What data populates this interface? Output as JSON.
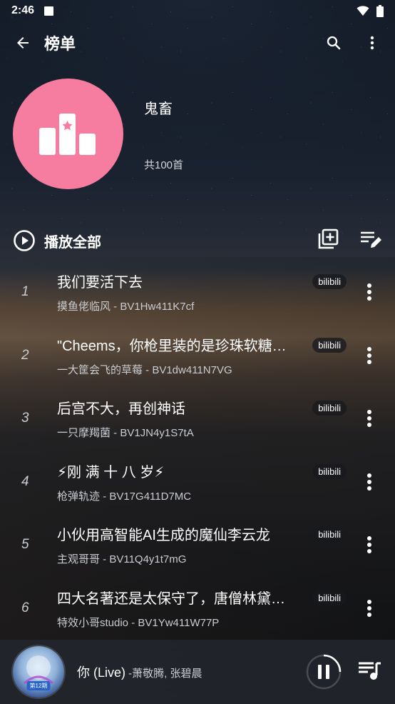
{
  "status": {
    "time": "2:46"
  },
  "appbar": {
    "title": "榜单"
  },
  "playlist": {
    "name": "鬼畜",
    "count": "共100首"
  },
  "play_all": {
    "label": "播放全部"
  },
  "songs": [
    {
      "index": "1",
      "title": "我们要活下去",
      "subtitle": "摸鱼佬临风 - BV1Hw411K7cf",
      "source": "bilibili"
    },
    {
      "index": "2",
      "title": "\"Cheems，你枪里装的是珍珠软糖…",
      "subtitle": "一大筐会飞的草莓 - BV1dw411N7VG",
      "source": "bilibili"
    },
    {
      "index": "3",
      "title": "后宫不大，再创神话",
      "subtitle": "一只摩羯菌 - BV1JN4y1S7tA",
      "source": "bilibili"
    },
    {
      "index": "4",
      "title": "⚡刚 满 十 八 岁⚡",
      "subtitle": "枪弹轨迹 - BV17G411D7MC",
      "source": "bilibili"
    },
    {
      "index": "5",
      "title": "小伙用高智能AI生成的魔仙李云龙",
      "subtitle": "主观哥哥 - BV11Q4y1t7mG",
      "source": "bilibili"
    },
    {
      "index": "6",
      "title": "四大名著还是太保守了，唐僧林黛…",
      "subtitle": "特效小哥studio - BV1Yw411W77P",
      "source": "bilibili"
    }
  ],
  "player": {
    "song": "你 (Live)",
    "artist": " -萧敬腾, 张碧晨",
    "art_tag": "第12期"
  },
  "colors": {
    "cover_pink": "#f67ca0",
    "player_bg": "#21252c"
  }
}
